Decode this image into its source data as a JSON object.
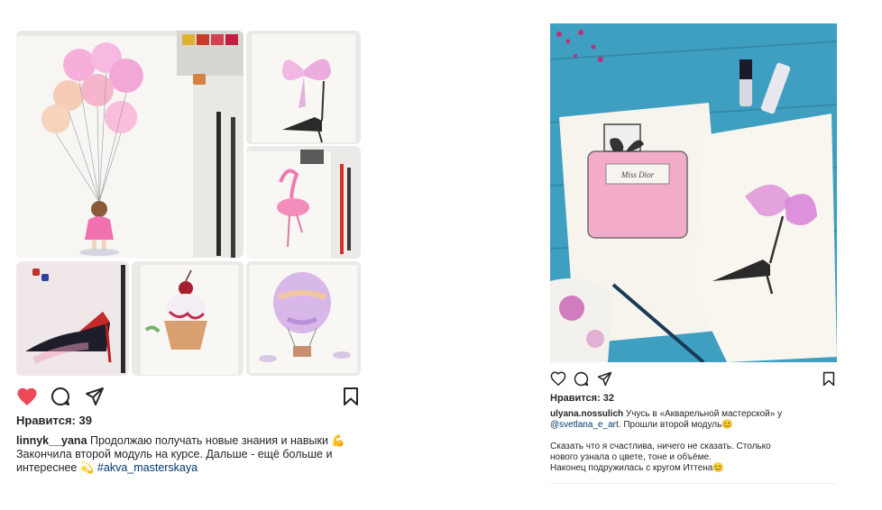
{
  "left_post": {
    "likes": "Нравится: 39",
    "liked": true,
    "caption": {
      "username": "linnyk__yana",
      "text_1": " Продолжаю получать новые знания и навыки ",
      "emoji_1": "💪",
      "text_2": " Закончила второй модуль на курсе. Дальше - ещё больше и интереснее ",
      "emoji_2": "💫",
      "hashtag": "#akva_masterskaya"
    },
    "images": [
      "Balloon girl",
      "Bow shoe",
      "Flamingo",
      "Red shoe",
      "Cupcake",
      "Air balloon"
    ]
  },
  "right_post": {
    "likes": "Нравится: 32",
    "liked": false,
    "perfume_label": "Miss Dior",
    "caption": {
      "username": "ulyana.nossulich",
      "text_1": " Учусь в «Акварельной мастерской» у ",
      "mention": "@svetlana_e_art",
      "text_2": ". Прошли второй модуль",
      "emoji_1": "😊",
      "para_2_line_1": "Сказать что я счастлива, ничего не сказать. Столько",
      "para_2_line_2": "нового узнала о цвете, тоне и объёме.",
      "para_2_line_3": "Наконец подружилась с кругом Иттена",
      "emoji_2": "😊"
    }
  },
  "icons": {
    "like": "heart-icon",
    "comment": "comment-icon",
    "share": "send-icon",
    "save": "bookmark-icon"
  },
  "colors": {
    "like_red": "#ed4956",
    "text": "#262626",
    "link": "#00376b",
    "wood_blue": "#3f9fc0"
  }
}
